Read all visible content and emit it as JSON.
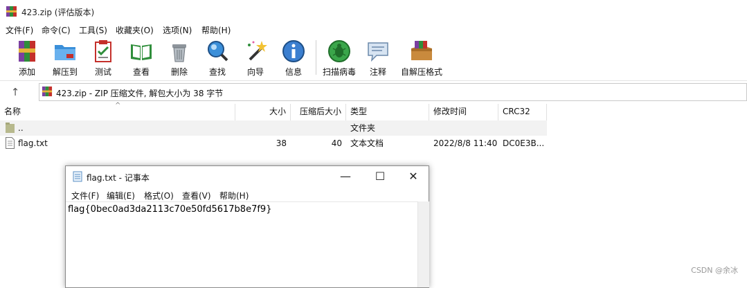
{
  "window": {
    "title": "423.zip (评估版本)"
  },
  "menu": [
    "文件(F)",
    "命令(C)",
    "工具(S)",
    "收藏夹(O)",
    "选项(N)",
    "帮助(H)"
  ],
  "toolbar": [
    {
      "label": "添加",
      "icon": "add-archive-icon"
    },
    {
      "label": "解压到",
      "icon": "extract-to-icon"
    },
    {
      "label": "测试",
      "icon": "test-icon"
    },
    {
      "label": "查看",
      "icon": "view-book-icon"
    },
    {
      "label": "删除",
      "icon": "trash-icon"
    },
    {
      "label": "查找",
      "icon": "magnifier-icon"
    },
    {
      "label": "向导",
      "icon": "wizard-wand-icon"
    },
    {
      "label": "信息",
      "icon": "info-icon"
    },
    {
      "label": "扫描病毒",
      "icon": "virus-scan-icon"
    },
    {
      "label": "注释",
      "icon": "comment-icon"
    },
    {
      "label": "自解压格式",
      "icon": "sfx-icon"
    }
  ],
  "address": {
    "text": "423.zip - ZIP 压缩文件, 解包大小为 38 字节"
  },
  "columns": [
    "名称",
    "大小",
    "压缩后大小",
    "类型",
    "修改时间",
    "CRC32"
  ],
  "files": [
    {
      "name": "..",
      "size": "",
      "packed": "",
      "type": "文件夹",
      "modified": "",
      "crc": ""
    },
    {
      "name": "flag.txt",
      "size": "38",
      "packed": "40",
      "type": "文本文档",
      "modified": "2022/8/8 11:40",
      "crc": "DC0E3B..."
    }
  ],
  "notepad": {
    "title": "flag.txt - 记事本",
    "menu": [
      "文件(F)",
      "编辑(E)",
      "格式(O)",
      "查看(V)",
      "帮助(H)"
    ],
    "content": "flag{0bec0ad3da2113c70e50fd5617b8e7f9}"
  },
  "watermark": "CSDN @余冰"
}
